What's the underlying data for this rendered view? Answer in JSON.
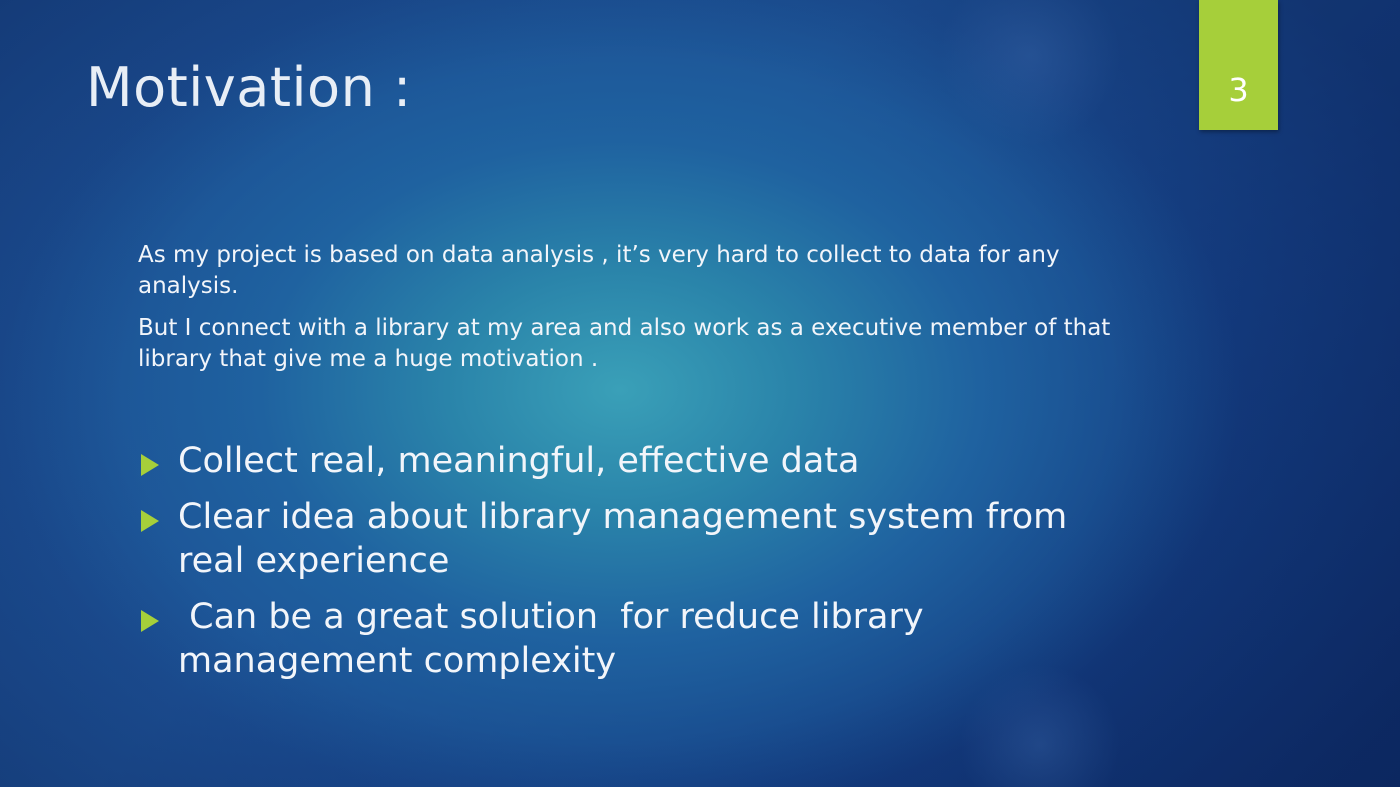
{
  "slide": {
    "title": "Motivation :",
    "page_number": "3",
    "accent_color": "#a6cf3a",
    "paragraphs": [
      "As my project is based on data analysis , it’s very hard to collect to data for any analysis.",
      "But I  connect with a library at my area and also work as a executive member of that library that give me a huge motivation ."
    ],
    "bullets": [
      "Collect real, meaningful, effective data",
      "Clear idea about library management system from real experience",
      " Can be a great solution  for reduce library management complexity"
    ],
    "bullet_icon": "right-triangle-icon"
  }
}
